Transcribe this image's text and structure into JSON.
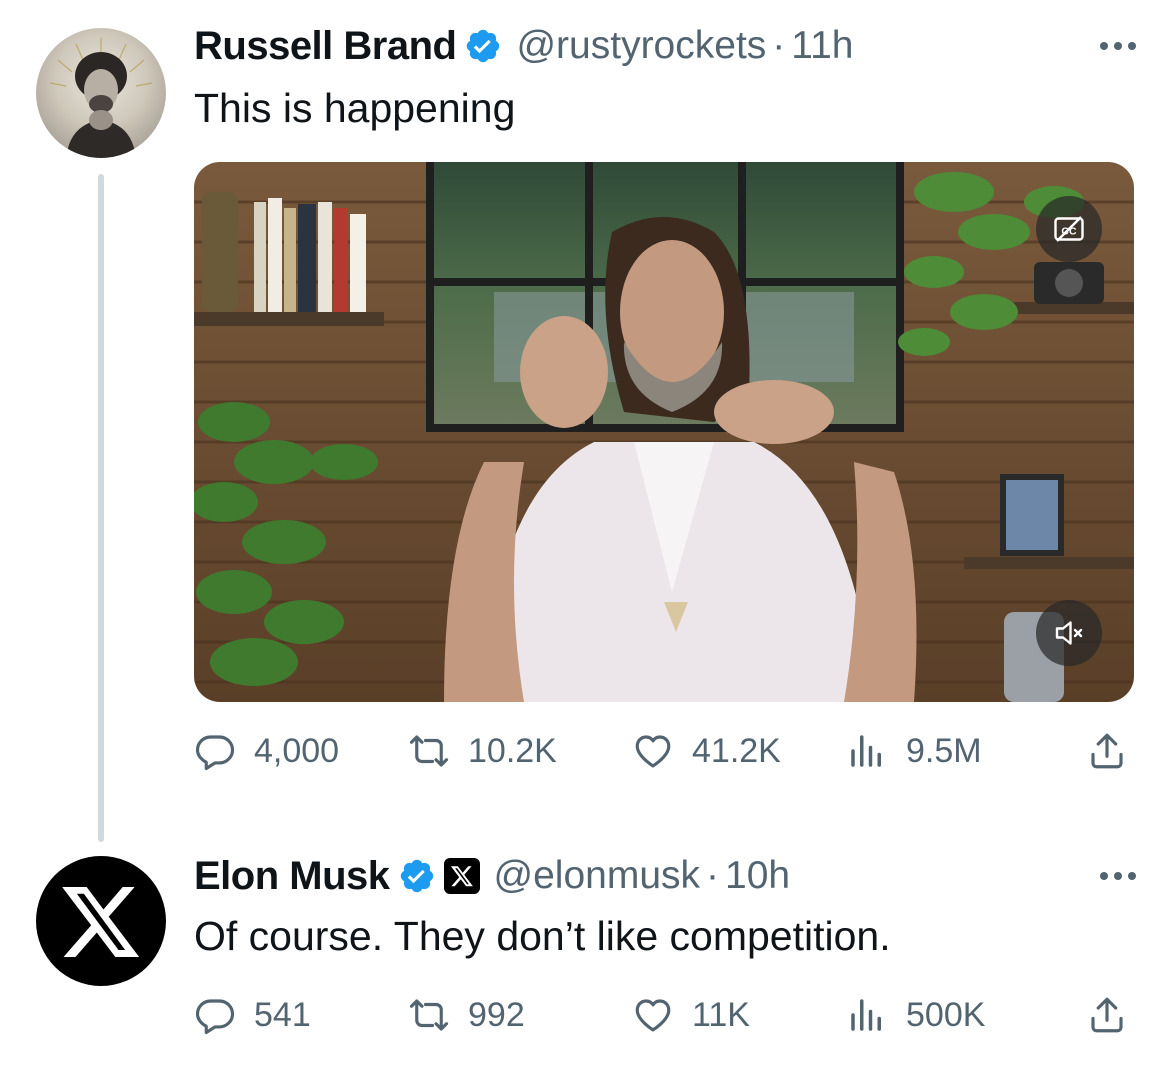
{
  "tweets": [
    {
      "author_name": "Russell Brand",
      "handle": "@rustyrockets",
      "separator": "·",
      "time": "11h",
      "text": "This is happening",
      "metrics": {
        "replies": "4,000",
        "retweets": "10.2K",
        "likes": "41.2K",
        "views": "9.5M"
      }
    },
    {
      "author_name": "Elon Musk",
      "handle": "@elonmusk",
      "separator": "·",
      "time": "10h",
      "text": "Of course. They don’t like competition.",
      "metrics": {
        "replies": "541",
        "retweets": "992",
        "likes": "11K",
        "views": "500K"
      }
    }
  ],
  "icons": {
    "reply": "reply-icon",
    "retweet": "retweet-icon",
    "like": "heart-icon",
    "views": "views-icon",
    "share": "share-icon",
    "verified": "verified-badge-icon",
    "captions": "captions-off-icon",
    "mute": "muted-speaker-icon"
  },
  "colors": {
    "verified": "#1d9bf0",
    "secondary_text": "#536471",
    "thread_line": "#cfd9de"
  }
}
